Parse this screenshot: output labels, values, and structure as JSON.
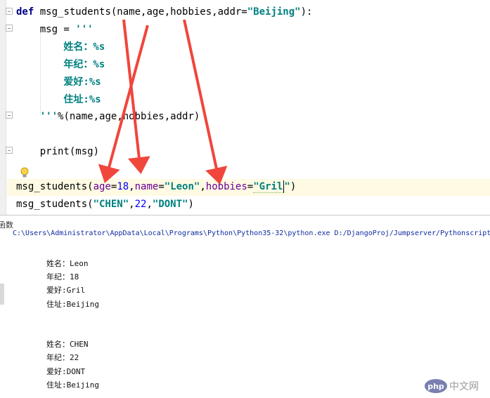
{
  "editor": {
    "lines": [
      {
        "segments": [
          {
            "t": "def",
            "c": "kw"
          },
          {
            "t": " msg_students(name,age,hobbies,addr=",
            "c": ""
          },
          {
            "t": "\"Beijing\"",
            "c": "str"
          },
          {
            "t": "):",
            "c": ""
          }
        ]
      },
      {
        "segments": [
          {
            "t": "    msg = ",
            "c": ""
          },
          {
            "t": "'''",
            "c": "str"
          }
        ]
      },
      {
        "segments": [
          {
            "t": "        姓名：%s",
            "c": "str"
          }
        ]
      },
      {
        "segments": [
          {
            "t": "        年纪：%s",
            "c": "str"
          }
        ]
      },
      {
        "segments": [
          {
            "t": "        爱好:%s",
            "c": "str"
          }
        ]
      },
      {
        "segments": [
          {
            "t": "        住址:%s",
            "c": "str"
          }
        ]
      },
      {
        "segments": [
          {
            "t": "    '''",
            "c": "str"
          },
          {
            "t": "%(name,age,hobbies,addr)",
            "c": ""
          }
        ]
      },
      {
        "segments": []
      },
      {
        "segments": [
          {
            "t": "    print(msg)",
            "c": ""
          }
        ]
      },
      {
        "segments": []
      },
      {
        "segments": [
          {
            "t": "msg_students(",
            "c": ""
          },
          {
            "t": "age",
            "c": "par"
          },
          {
            "t": "=",
            "c": ""
          },
          {
            "t": "18",
            "c": "num"
          },
          {
            "t": ",",
            "c": ""
          },
          {
            "t": "name",
            "c": "par"
          },
          {
            "t": "=",
            "c": ""
          },
          {
            "t": "\"Leon\"",
            "c": "str"
          },
          {
            "t": ",",
            "c": ""
          },
          {
            "t": "hobbies",
            "c": "par"
          },
          {
            "t": "=",
            "c": ""
          },
          {
            "t": "\"Gril",
            "c": "str sq"
          },
          {
            "t": "",
            "c": "caret"
          },
          {
            "t": "\"",
            "c": "str"
          },
          {
            "t": ")",
            "c": ""
          }
        ]
      },
      {
        "segments": [
          {
            "t": "msg_students(",
            "c": ""
          },
          {
            "t": "\"CHEN\"",
            "c": "str"
          },
          {
            "t": ",",
            "c": ""
          },
          {
            "t": "22",
            "c": "num"
          },
          {
            "t": ",",
            "c": ""
          },
          {
            "t": "\"DONT\"",
            "c": "str"
          },
          {
            "t": ")",
            "c": ""
          }
        ]
      }
    ]
  },
  "console": {
    "tab_label": "函数",
    "command": "C:\\Users\\Administrator\\AppData\\Local\\Programs\\Python\\Python35-32\\python.exe D:/DjangoProj/Jumpserver/Pythonscript",
    "output_lines": [
      "姓名：Leon",
      "年纪：18",
      "爱好:Gril",
      "住址:Beijing",
      "",
      "",
      "姓名：CHEN",
      "年纪：22",
      "爱好:DONT",
      "住址:Beijing"
    ]
  },
  "watermark": {
    "badge": "php",
    "text": "中文网"
  },
  "colors": {
    "keyword": "#000080",
    "string": "#008080",
    "number": "#0000ff",
    "param": "#660099",
    "arrow": "#f0463c",
    "current_line": "#fffae3"
  }
}
